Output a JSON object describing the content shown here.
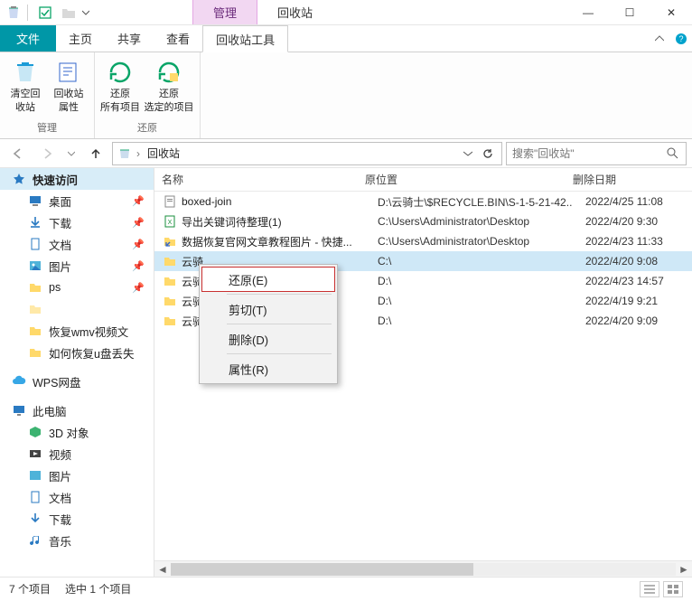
{
  "titlebar": {
    "manage_tab": "管理",
    "title": "回收站"
  },
  "window_controls": {
    "min": "—",
    "max": "☐",
    "close": "✕"
  },
  "menutabs": {
    "file": "文件",
    "home": "主页",
    "share": "共享",
    "view": "查看",
    "tool": "回收站工具"
  },
  "ribbon": {
    "group1": {
      "label": "管理",
      "btn1_l1": "清空回",
      "btn1_l2": "收站",
      "btn2_l1": "回收站",
      "btn2_l2": "属性"
    },
    "group2": {
      "label": "还原",
      "btn1_l1": "还原",
      "btn1_l2": "所有项目",
      "btn2_l1": "还原",
      "btn2_l2": "选定的项目"
    }
  },
  "address": {
    "location": "回收站",
    "search_placeholder": "搜索\"回收站\""
  },
  "columns": {
    "name": "名称",
    "loc": "原位置",
    "date": "删除日期"
  },
  "sidebar": {
    "quick": "快速访问",
    "items": [
      {
        "label": "桌面",
        "pin": true
      },
      {
        "label": "下载",
        "pin": true
      },
      {
        "label": "文档",
        "pin": true
      },
      {
        "label": "图片",
        "pin": true
      },
      {
        "label": "ps",
        "pin": true
      },
      {
        "label": "",
        "pin": false
      },
      {
        "label": "恢复wmv视频文",
        "pin": false
      },
      {
        "label": "如何恢复u盘丢失",
        "pin": false
      }
    ],
    "wps": "WPS网盘",
    "pc": "此电脑",
    "pc_items": [
      "3D 对象",
      "视频",
      "图片",
      "文档",
      "下载",
      "音乐"
    ]
  },
  "files": [
    {
      "icon": "doc",
      "name": "boxed-join",
      "loc": "D:\\云骑士\\$RECYCLE.BIN\\S-1-5-21-42..",
      "date": "2022/4/25 11:08"
    },
    {
      "icon": "xls",
      "name": "导出关键词待整理(1)",
      "loc": "C:\\Users\\Administrator\\Desktop",
      "date": "2022/4/20 9:30"
    },
    {
      "icon": "lnk",
      "name": "数据恢复官网文章教程图片 - 快捷...",
      "loc": "C:\\Users\\Administrator\\Desktop",
      "date": "2022/4/23 11:33"
    },
    {
      "icon": "folder",
      "name": "云骑",
      "loc": "C:\\",
      "date": "2022/4/20 9:08",
      "selected": true
    },
    {
      "icon": "folder",
      "name": "云骑",
      "loc": "D:\\",
      "date": "2022/4/23 14:57"
    },
    {
      "icon": "folder",
      "name": "云骑",
      "loc": "D:\\",
      "date": "2022/4/19 9:21"
    },
    {
      "icon": "folder",
      "name": "云骑",
      "loc": "D:\\",
      "date": "2022/4/20 9:09"
    }
  ],
  "context_menu": {
    "restore": "还原(E)",
    "cut": "剪切(T)",
    "delete": "删除(D)",
    "props": "属性(R)"
  },
  "status": {
    "count": "7 个项目",
    "selected": "选中 1 个项目"
  }
}
